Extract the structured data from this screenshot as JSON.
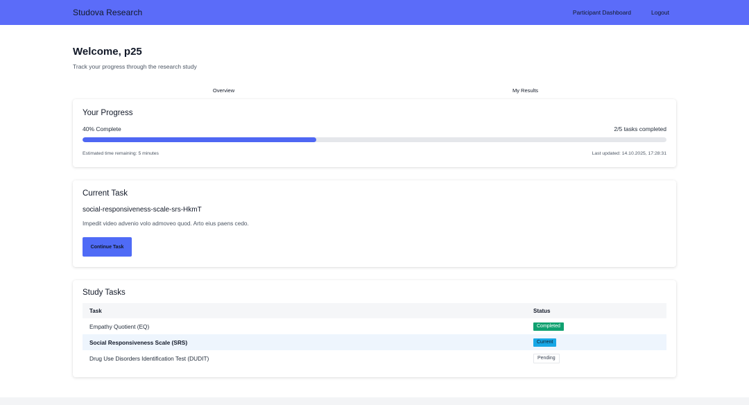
{
  "header": {
    "brand": "Studova Research",
    "nav": [
      {
        "label": "Participant Dashboard"
      },
      {
        "label": "Logout"
      }
    ],
    "background_color": "#5b6cf9"
  },
  "welcome": {
    "title": "Welcome, p25",
    "subtitle": "Track your progress through the research study"
  },
  "tabs": [
    {
      "label": "Overview"
    },
    {
      "label": "My Results"
    }
  ],
  "progress": {
    "title": "Your Progress",
    "percent_label": "40% Complete",
    "percent_value": 40,
    "tasks_label": "2/5 tasks completed",
    "estimated": "Estimated time remaining: 5 minutes",
    "last_updated": "Last updated: 14.10.2025, 17:28:31",
    "bar_color": "#4f67f3"
  },
  "current_task": {
    "title": "Current Task",
    "code": "social-responsiveness-scale-srs-HkmT",
    "description": "Impedit video advenio volo admoveo quod. Arto eius paens cedo.",
    "button_label": "Continue Task"
  },
  "study_tasks": {
    "title": "Study Tasks",
    "columns": [
      "Task",
      "Status"
    ],
    "rows": [
      {
        "task": "Empathy Quotient (EQ)",
        "status": "Completed",
        "state": "completed"
      },
      {
        "task": "Social Responsiveness Scale (SRS)",
        "status": "Current",
        "state": "current"
      },
      {
        "task": "Drug Use Disorders Identification Test (DUDIT)",
        "status": "Pending",
        "state": "pending"
      }
    ],
    "status_colors": {
      "completed": "#10a170",
      "current": "#17a7e6",
      "pending": "#ffffff"
    }
  }
}
